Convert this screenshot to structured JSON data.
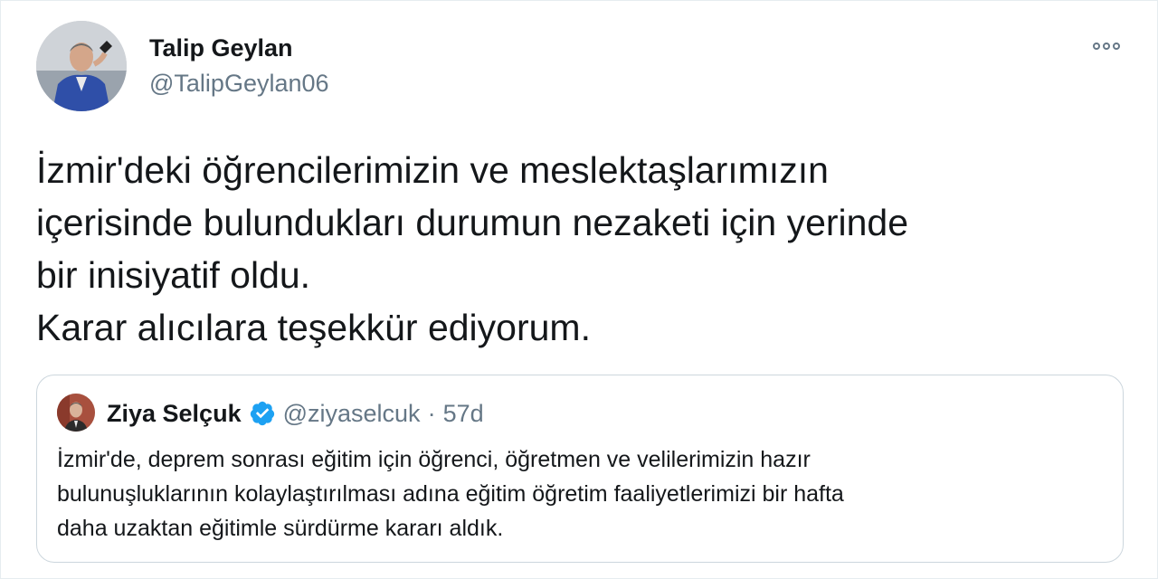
{
  "tweet": {
    "author": {
      "name": "Talip Geylan",
      "handle": "@TalipGeylan06",
      "avatar_icon": "profile-photo-speaker"
    },
    "more_icon": "more-options-icon",
    "text_lines": [
      "İzmir'deki öğrencilerimizin ve meslektaşlarımızın",
      "içerisinde bulundukları durumun nezaketi için yerinde",
      "bir inisiyatif oldu.",
      "Karar alıcılara teşekkür ediyorum."
    ],
    "quoted": {
      "author_name": "Ziya Selçuk",
      "verified": true,
      "handle": "@ziyaselcuk",
      "separator": "·",
      "time": "57d",
      "text_lines": [
        "İzmir'de, deprem sonrası eğitim için öğrenci, öğretmen ve velilerimizin hazır",
        "bulunuşluklarının kolaylaştırılması adına eğitim öğretim faaliyetlerimizi bir hafta",
        "daha uzaktan eğitimle sürdürme kararı aldık."
      ]
    }
  },
  "colors": {
    "text_primary": "#14171a",
    "text_secondary": "#657786",
    "verified_blue": "#1da1f2",
    "border": "#ccd6dd"
  }
}
